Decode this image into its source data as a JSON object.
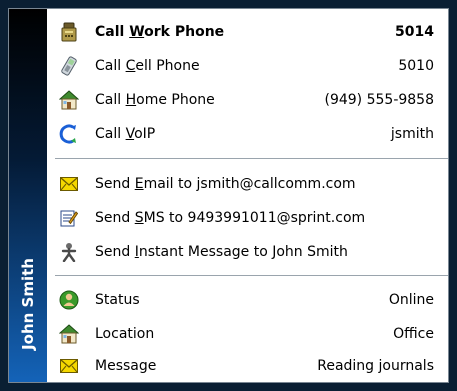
{
  "menu": {
    "sidebar_title": "John Smith",
    "call_items": [
      {
        "icon": "desk-phone-icon",
        "label_pre": "Call ",
        "label_acc": "W",
        "label_post": "ork Phone",
        "value": "5014",
        "bold": true
      },
      {
        "icon": "cell-phone-icon",
        "label_pre": "Call ",
        "label_acc": "C",
        "label_post": "ell Phone",
        "value": "5010"
      },
      {
        "icon": "home-icon",
        "label_pre": "Call ",
        "label_acc": "H",
        "label_post": "ome Phone",
        "value": "(949) 555-9858"
      },
      {
        "icon": "voip-icon",
        "label_pre": "Call ",
        "label_acc": "V",
        "label_post": "oIP",
        "value": "jsmith"
      }
    ],
    "send_items": [
      {
        "icon": "email-icon",
        "label_pre": "Send ",
        "label_acc": "E",
        "label_post": "mail to jsmith@callcomm.com"
      },
      {
        "icon": "sms-icon",
        "label_pre": "Send ",
        "label_acc": "S",
        "label_post": "MS to 9493991011@sprint.com"
      },
      {
        "icon": "instant-message-icon",
        "label_pre": "Send ",
        "label_acc": "I",
        "label_post": "nstant Message to John Smith"
      }
    ],
    "info_items": [
      {
        "icon": "status-icon",
        "label": "Status",
        "value": "Online"
      },
      {
        "icon": "location-icon",
        "label": "Location",
        "value": "Office"
      },
      {
        "icon": "message-icon",
        "label": "Message",
        "value": "Reading journals"
      }
    ]
  }
}
